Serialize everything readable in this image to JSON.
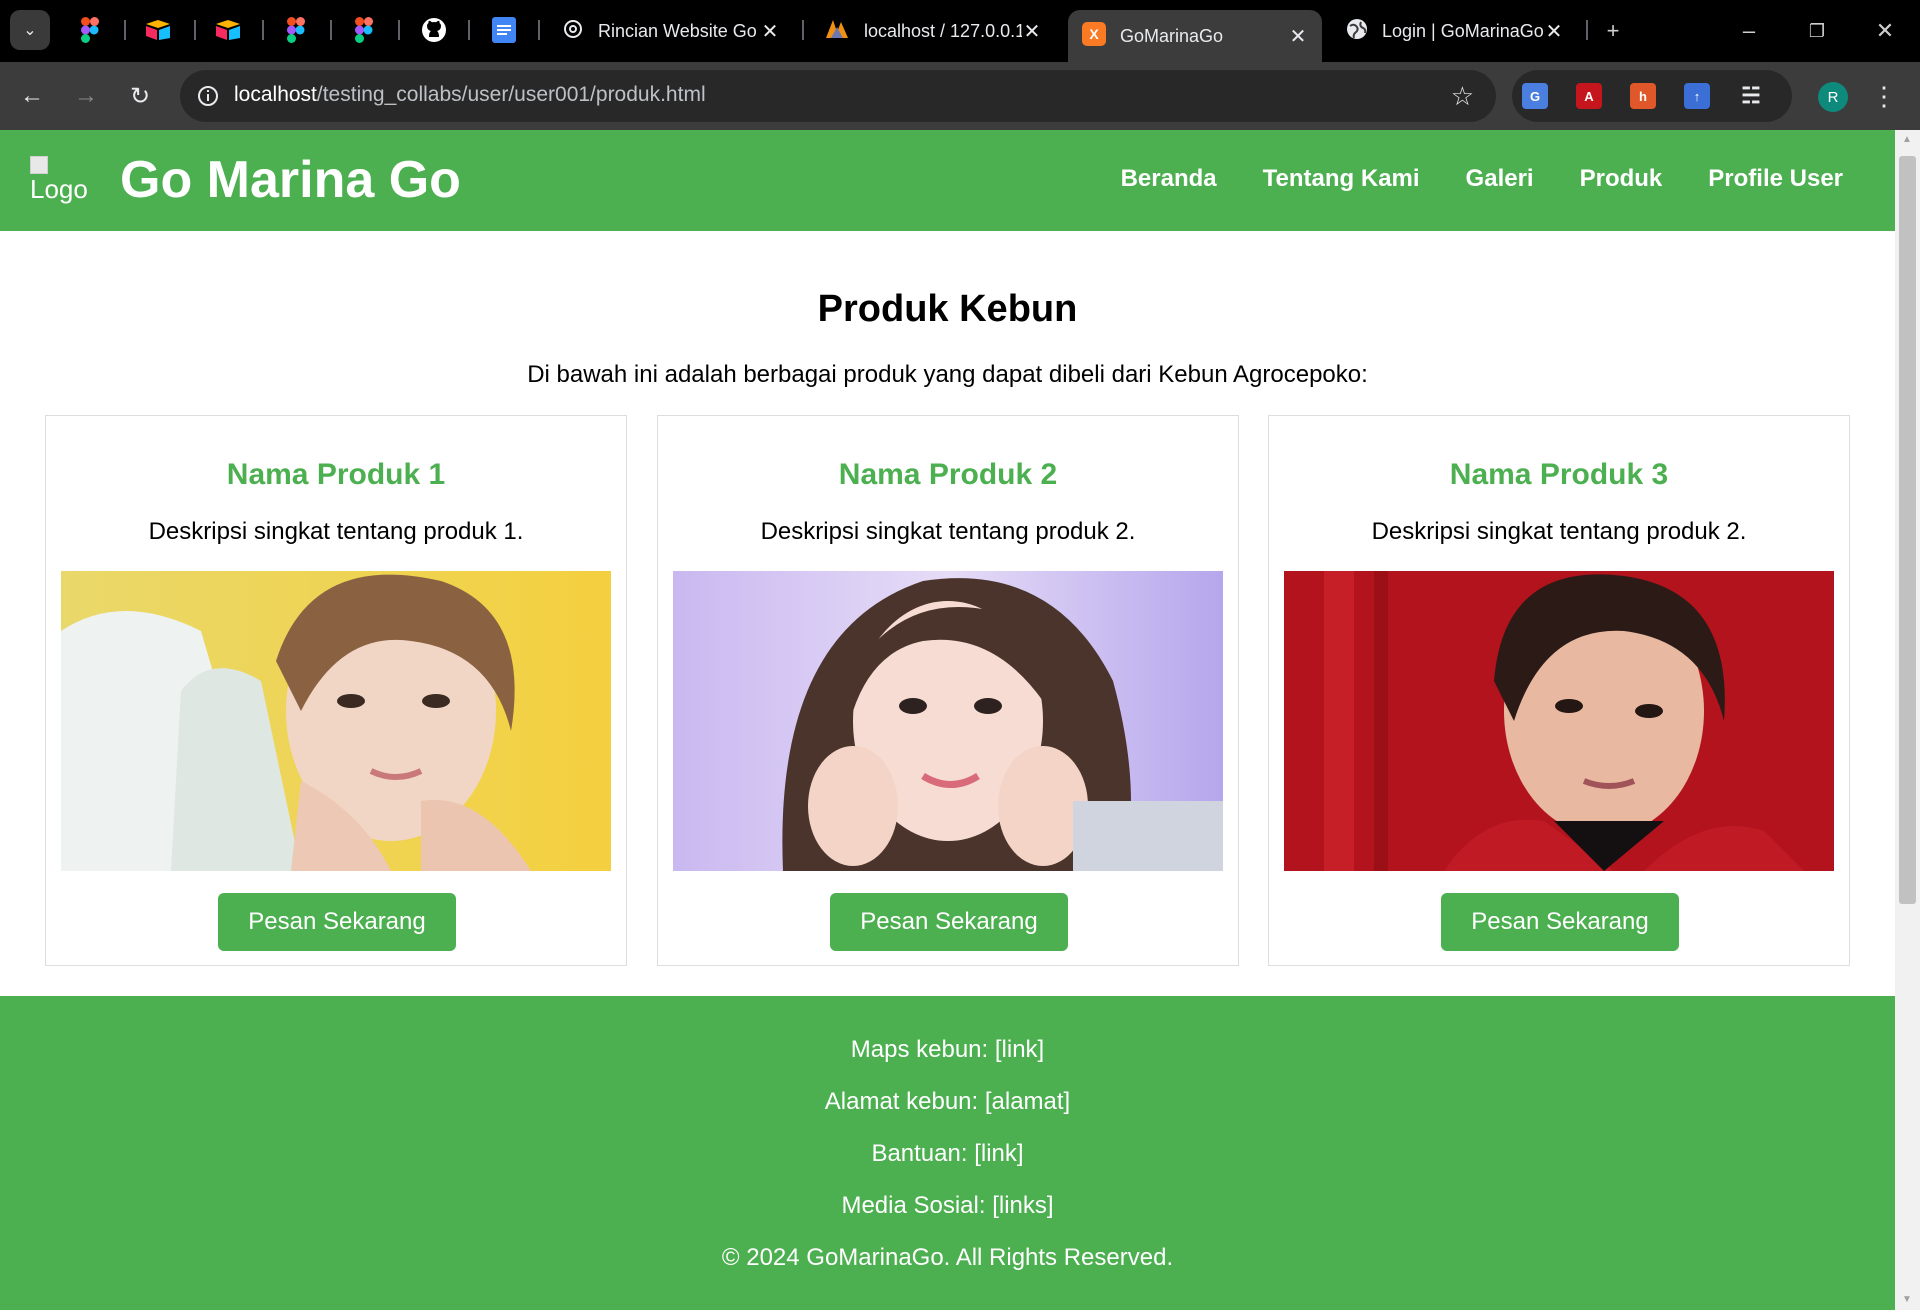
{
  "browser": {
    "tabs": [
      {
        "title": "Rincian Website Go",
        "icon": "chatgpt-icon"
      },
      {
        "title": "localhost / 127.0.0.1",
        "icon": "phpmyadmin-icon"
      },
      {
        "title": "GoMarinaGo",
        "icon": "xampp-icon",
        "active": true
      },
      {
        "title": "Login | GoMarinaGo",
        "icon": "globe-icon"
      }
    ],
    "pinned_icons": [
      "figma-icon",
      "airtable-icon",
      "airtable-icon",
      "figma-icon",
      "figma-icon",
      "github-icon",
      "google-docs-icon"
    ],
    "url_host": "localhost",
    "url_path": "/testing_collabs/user/user001/produk.html",
    "avatar_letter": "R"
  },
  "header": {
    "logo_alt": "Logo",
    "title": "Go Marina Go",
    "nav": [
      "Beranda",
      "Tentang Kami",
      "Galeri",
      "Produk",
      "Profile User"
    ]
  },
  "main": {
    "title": "Produk Kebun",
    "description": "Di bawah ini adalah berbagai produk yang dapat dibeli dari Kebun Agrocepoko:",
    "products": [
      {
        "name": "Nama Produk 1",
        "desc": "Deskripsi singkat tentang produk 1.",
        "button": "Pesan Sekarang"
      },
      {
        "name": "Nama Produk 2",
        "desc": "Deskripsi singkat tentang produk 2.",
        "button": "Pesan Sekarang"
      },
      {
        "name": "Nama Produk 3",
        "desc": "Deskripsi singkat tentang produk 2.",
        "button": "Pesan Sekarang"
      }
    ]
  },
  "footer": {
    "maps": "Maps kebun: [link]",
    "address": "Alamat kebun: [alamat]",
    "help": "Bantuan: [link]",
    "social": "Media Sosial: [links]",
    "copyright": "© 2024 GoMarinaGo. All Rights Reserved."
  },
  "colors": {
    "brand_green": "#4caf50",
    "browser_dark": "#3c3c3c"
  }
}
